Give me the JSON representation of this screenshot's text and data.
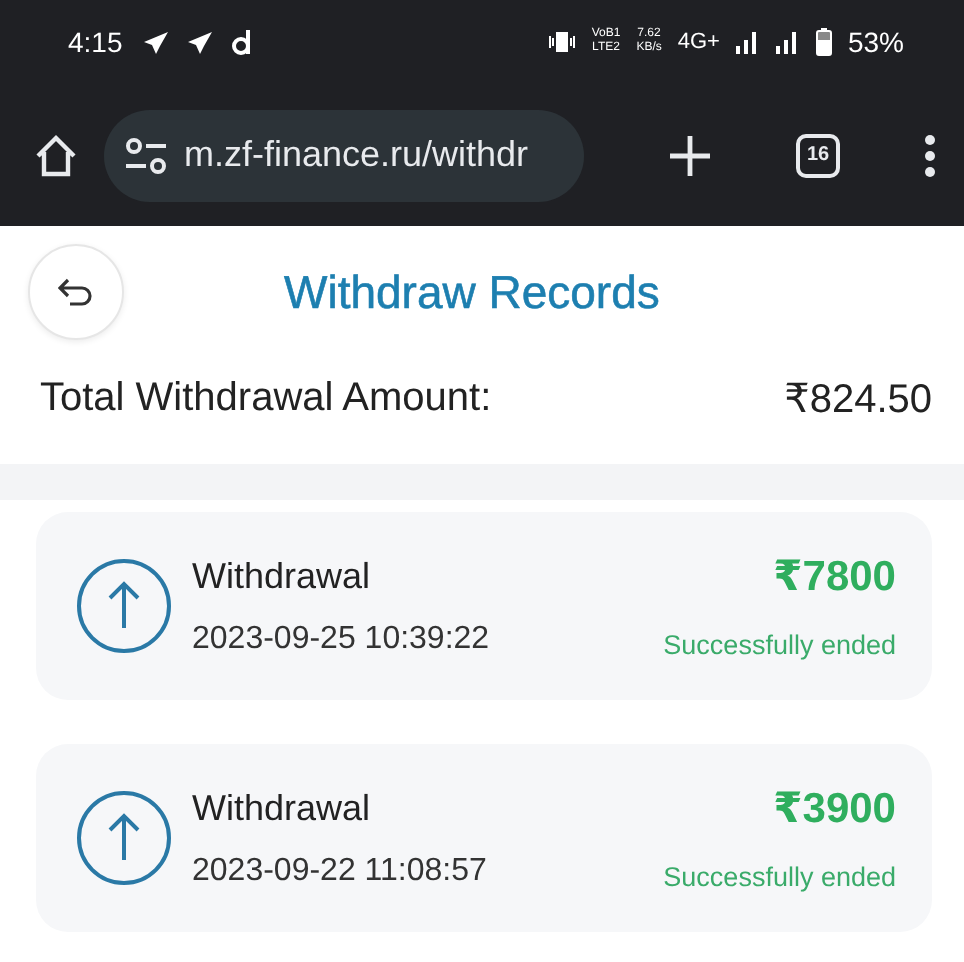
{
  "status_bar": {
    "time": "4:15",
    "volte": "VoB1",
    "lte": "LTE2",
    "speed_value": "7.62",
    "speed_unit": "KB/s",
    "network": "4G+",
    "battery": "53%"
  },
  "browser": {
    "url": "m.zf-finance.ru/withdr",
    "tab_count": "16"
  },
  "header": {
    "title": "Withdraw Records"
  },
  "summary": {
    "label": "Total Withdrawal Amount:",
    "value": "₹824.50"
  },
  "records": [
    {
      "title": "Withdrawal",
      "date": "2023-09-25 10:39:22",
      "amount": "₹7800",
      "status": "Successfully ended"
    },
    {
      "title": "Withdrawal",
      "date": "2023-09-22 11:08:57",
      "amount": "₹3900",
      "status": "Successfully ended"
    }
  ]
}
